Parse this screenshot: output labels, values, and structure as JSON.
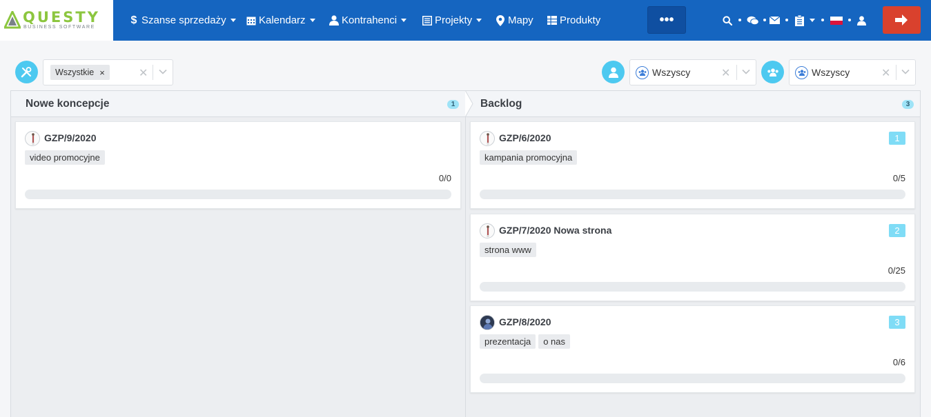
{
  "logo": {
    "name": "QUESTY",
    "tagline": "BUSINESS SOFTWARE"
  },
  "nav": {
    "items": [
      {
        "label": "Szanse sprzedaży",
        "icon": "dollar-icon"
      },
      {
        "label": "Kalendarz",
        "icon": "calendar-icon"
      },
      {
        "label": "Kontrahenci",
        "icon": "user-icon"
      },
      {
        "label": "Projekty",
        "icon": "list-icon"
      },
      {
        "label": "Mapy",
        "icon": "map-marker-icon"
      },
      {
        "label": "Produkty",
        "icon": "table-icon"
      }
    ],
    "more_label": "•••"
  },
  "filters": {
    "category_chip": "Wszystkie",
    "user_filter_1": "Wszyscy",
    "user_filter_2": "Wszyscy"
  },
  "columns": [
    {
      "title": "Nowe koncepcje",
      "count": "1",
      "cards": [
        {
          "title": "GZP/9/2020",
          "number": "",
          "tags": [
            "video promocyjne"
          ],
          "progress": "0/0",
          "progress_fraction": 0
        }
      ]
    },
    {
      "title": "Backlog",
      "count": "3",
      "cards": [
        {
          "title": "GZP/6/2020",
          "number": "1",
          "tags": [
            "kampania promocyjna"
          ],
          "progress": "0/5",
          "progress_fraction": 0
        },
        {
          "title": "GZP/7/2020 Nowa strona",
          "number": "2",
          "tags": [
            "strona www"
          ],
          "progress": "0/25",
          "progress_fraction": 0
        },
        {
          "title": "GZP/8/2020",
          "number": "3",
          "tags": [
            "prezentacja",
            "o nas"
          ],
          "progress": "0/6",
          "progress_fraction": 0
        }
      ]
    }
  ],
  "colors": {
    "nav_bg": "#1565c0",
    "logout_bg": "#d9412d",
    "accent_cyan": "#4dc9f0",
    "logo_green": "#8cc63f"
  }
}
